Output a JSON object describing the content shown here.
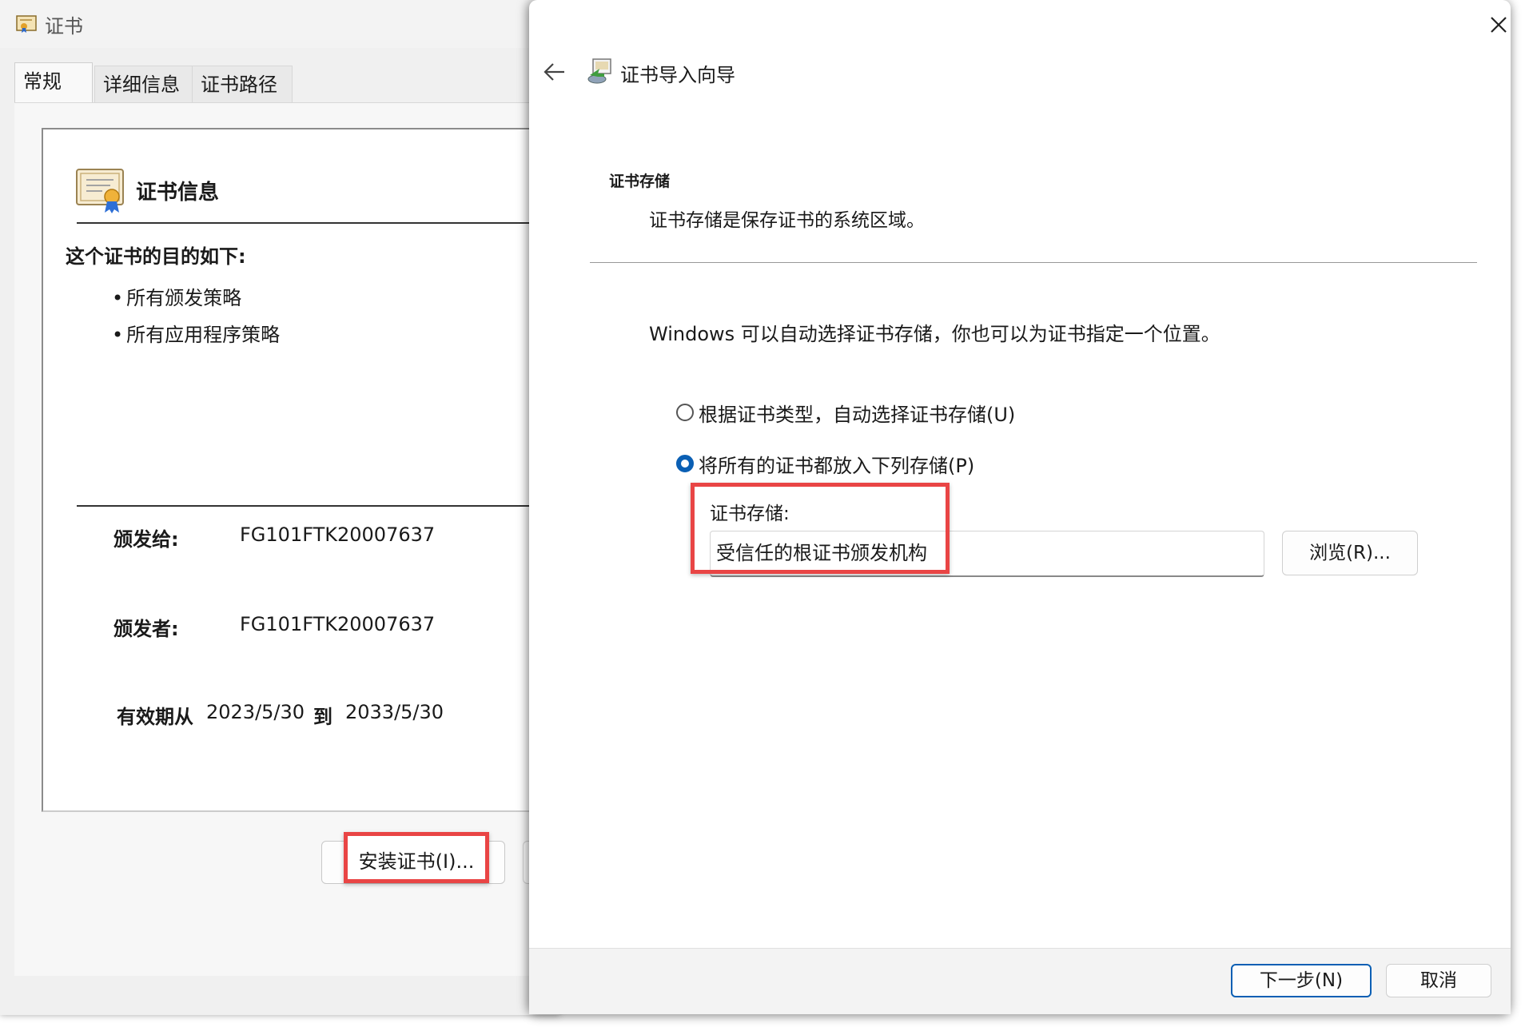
{
  "cert_window": {
    "title": "证书",
    "tabs": [
      "常规",
      "详细信息",
      "证书路径"
    ],
    "info_title": "证书信息",
    "purpose_heading": "这个证书的目的如下:",
    "purposes": [
      "所有颁发策略",
      "所有应用程序策略"
    ],
    "issued_to_label": "颁发给:",
    "issued_to_value": "FG101FTK20007637",
    "issued_by_label": "颁发者:",
    "issued_by_value": "FG101FTK20007637",
    "valid_from_label": "有效期从",
    "valid_from_value": "2023/5/30",
    "valid_to_label": "到",
    "valid_to_value": "2033/5/30",
    "install_button_label": "安装证书(I)..."
  },
  "wizard": {
    "title": "证书导入向导",
    "close_icon": "close-icon",
    "back_icon": "back-arrow-icon",
    "store_heading": "证书存储",
    "store_description": "证书存储是保存证书的系统区域。",
    "store_intro": "Windows 可以自动选择证书存储，你也可以为证书指定一个位置。",
    "radio_auto_label": "根据证书类型，自动选择证书存储(U)",
    "radio_manual_label": "将所有的证书都放入下列存储(P)",
    "selected_option": "manual",
    "store_field_label": "证书存储:",
    "store_field_value": "受信任的根证书颁发机构",
    "browse_label": "浏览(R)...",
    "next_label": "下一步(N)",
    "cancel_label": "取消"
  },
  "colors": {
    "highlight": "#e94545",
    "accent": "#0a5fb4"
  }
}
